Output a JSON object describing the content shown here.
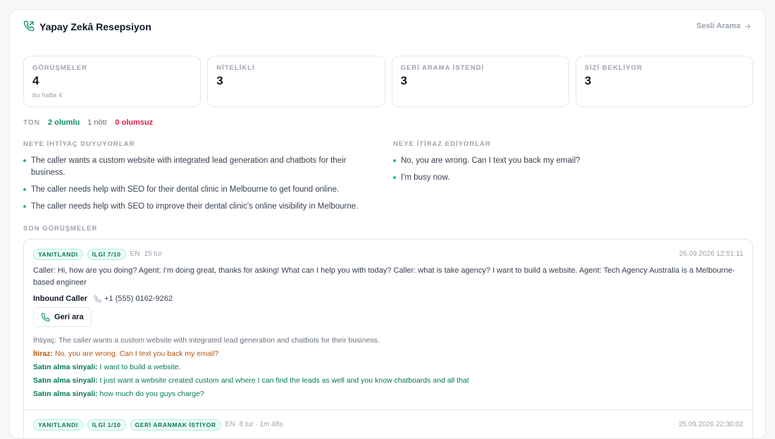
{
  "header": {
    "title": "Yapay Zekâ Resepsiyon",
    "voice_call": "Sesli Arama"
  },
  "stats": [
    {
      "label": "GÖRÜŞMELER",
      "value": "4",
      "sub": "bu hafta 4"
    },
    {
      "label": "NİTELİKLİ",
      "value": "3"
    },
    {
      "label": "GERİ ARAMA İSTENDİ",
      "value": "3"
    },
    {
      "label": "SİZİ BEKLİYOR",
      "value": "3"
    }
  ],
  "tone": {
    "label": "TON",
    "positive": "2 olumlu",
    "neutral": "1 nötr",
    "negative": "0 olumsuz"
  },
  "needs": {
    "title": "NEYE İHTİYAÇ DUYUYORLAR",
    "items": [
      "The caller wants a custom website with integrated lead generation and chatbots for their business.",
      "The caller needs help with SEO for their dental clinic in Melbourne to get found online.",
      "The caller needs help with SEO to improve their dental clinic's online visibility in Melbourne."
    ]
  },
  "objections": {
    "title": "NEYE İTİRAZ EDİYORLAR",
    "items": [
      "No, you are wrong. Can I text you back my email?",
      "I'm busy now."
    ]
  },
  "recent": {
    "title": "SON GÖRÜŞMELER",
    "calls": [
      {
        "badges": [
          "YANITLANDI",
          "İLGİ 7/10"
        ],
        "lang": "EN",
        "turns": "15 tur",
        "time": "26.09.2026 12:51:11",
        "transcript": "Caller: Hi, how are you doing? Agent: I'm doing great, thanks for asking! What can I help you with today? Caller: what is take agency? I want to build a website. Agent: Tech Agency Australia is a Melbourne-based engineer",
        "caller_name": "Inbound Caller",
        "caller_phone": "+1 (555) 0162-9262",
        "callback_label": "Geri ara",
        "need_label": "İhtiyaç:",
        "need": "The caller wants a custom website with integrated lead generation and chatbots for their business.",
        "objection_label": "İtiraz:",
        "objection": "No, you are wrong. Can I text you back my email?",
        "signal_label": "Satın alma sinyali:",
        "signals": [
          "I want to build a website.",
          "I just want a website created custom and where I can find the leads as well and you know chatboards and all that",
          "how much do you guys charge?"
        ]
      },
      {
        "badges": [
          "YANITLANDI",
          "İLGİ 1/10",
          "GERİ ARANMAK İSTİYOR"
        ],
        "lang": "EN",
        "turns": "8 tur · 1m 48s",
        "time": "25.09.2026 22:30:02"
      }
    ]
  },
  "colors": {
    "accent": "#059669",
    "negative": "#e11d48",
    "objection": "#b45309"
  }
}
